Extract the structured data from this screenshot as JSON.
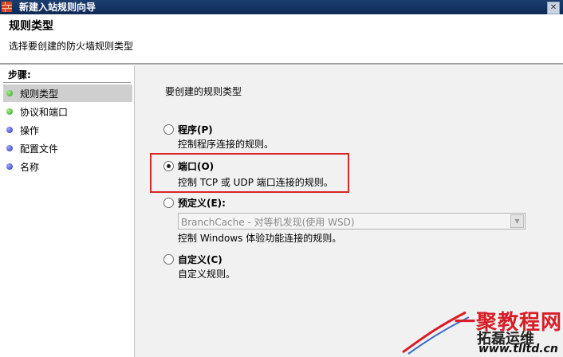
{
  "window": {
    "title": "新建入站规则向导"
  },
  "header": {
    "title": "规则类型",
    "subtitle": "选择要创建的防火墙规则类型"
  },
  "steps": {
    "header": "步骤:",
    "items": [
      {
        "label": "规则类型",
        "status": "green"
      },
      {
        "label": "协议和端口",
        "status": "green"
      },
      {
        "label": "操作",
        "status": "blue"
      },
      {
        "label": "配置文件",
        "status": "blue"
      },
      {
        "label": "名称",
        "status": "blue"
      }
    ]
  },
  "main": {
    "heading": "要创建的规则类型",
    "options": [
      {
        "label": "程序(P)",
        "description": "控制程序连接的规则。",
        "selected": false
      },
      {
        "label": "端口(O)",
        "description": "控制 TCP 或 UDP 端口连接的规则。",
        "selected": true
      },
      {
        "label": "预定义(E):",
        "description": "控制 Windows 体验功能连接的规则。",
        "selected": false,
        "dropdown_value": "BranchCache - 对等机发现(使用 WSD)"
      },
      {
        "label": "自定义(C)",
        "description": "自定义规则。",
        "selected": false
      }
    ]
  },
  "watermark": {
    "main": "一聚教程网",
    "sub": "拓磊运维",
    "url": "www.tlltd.cn"
  },
  "colors": {
    "highlight_border": "#d9262a",
    "titlebar": "#0e2a55"
  }
}
